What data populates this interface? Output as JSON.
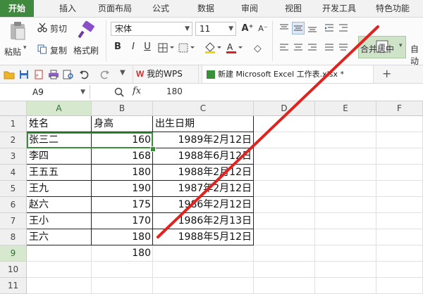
{
  "menu": {
    "tabs": [
      {
        "label": "开始",
        "active": true
      },
      {
        "label": "插入"
      },
      {
        "label": "页面布局"
      },
      {
        "label": "公式"
      },
      {
        "label": "数据"
      },
      {
        "label": "审阅"
      },
      {
        "label": "视图"
      },
      {
        "label": "开发工具"
      },
      {
        "label": "特色功能"
      }
    ]
  },
  "ribbon": {
    "paste_label": "粘贴",
    "cut_label": "剪切",
    "copy_label": "复制",
    "format_painter_label": "格式刷",
    "font_name": "宋体",
    "font_size": "11",
    "merge_label": "合并居中",
    "auto_label": "自动",
    "grow_font": "A⁺",
    "shrink_font": "A⁻",
    "bold": "B",
    "italic": "I",
    "underline": "U"
  },
  "quick_access": {
    "doc_tabs": [
      {
        "label": "我的WPS"
      },
      {
        "label": "新建 Microsoft Excel 工作表.xlsx *"
      }
    ],
    "add_tab": "+"
  },
  "formula_bar": {
    "cell_ref": "A9",
    "fx_label": "fx",
    "value": "180"
  },
  "sheet": {
    "columns": [
      "A",
      "B",
      "C",
      "D",
      "E",
      "F"
    ],
    "rows": [
      "1",
      "2",
      "3",
      "4",
      "5",
      "6",
      "7",
      "8",
      "9",
      "10",
      "11"
    ],
    "data": [
      [
        "姓名",
        "身高",
        "出生日期"
      ],
      [
        "张三二",
        "160",
        "1989年2月12日"
      ],
      [
        "李四",
        "168",
        "1988年6月12日"
      ],
      [
        "王五五",
        "180",
        "1988年2月12日"
      ],
      [
        "王九",
        "190",
        "1987年2月12日"
      ],
      [
        "赵六",
        "175",
        "1986年2月12日"
      ],
      [
        "王小",
        "170",
        "1986年2月13日"
      ],
      [
        "王六",
        "180",
        "1988年5月12日"
      ],
      [
        "",
        "180",
        ""
      ]
    ]
  },
  "colors": {
    "accent": "#3f8a3f",
    "annotation_line": "#e0231f"
  }
}
